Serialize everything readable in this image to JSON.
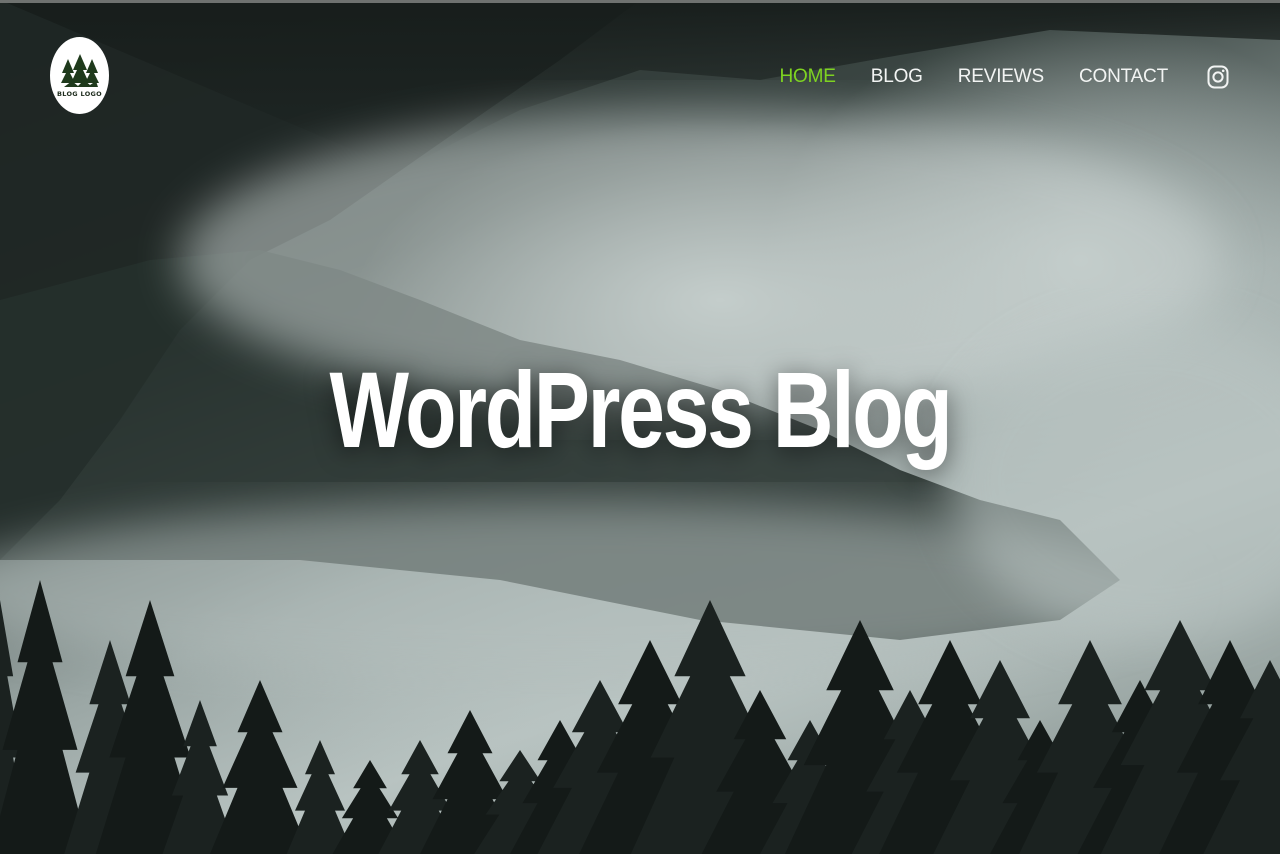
{
  "logo": {
    "text": "BLOG LOGO",
    "icon": "pine-trees-logo"
  },
  "nav": {
    "items": [
      {
        "label": "HOME",
        "active": true
      },
      {
        "label": "BLOG",
        "active": false
      },
      {
        "label": "REVIEWS",
        "active": false
      },
      {
        "label": "CONTACT",
        "active": false
      }
    ],
    "social_icon": "instagram-icon"
  },
  "hero": {
    "title": "WordPress Blog",
    "background": "misty-pine-forest"
  },
  "colors": {
    "accent": "#7ed321",
    "nav_text": "#f2f4f3",
    "title": "#ffffff"
  }
}
